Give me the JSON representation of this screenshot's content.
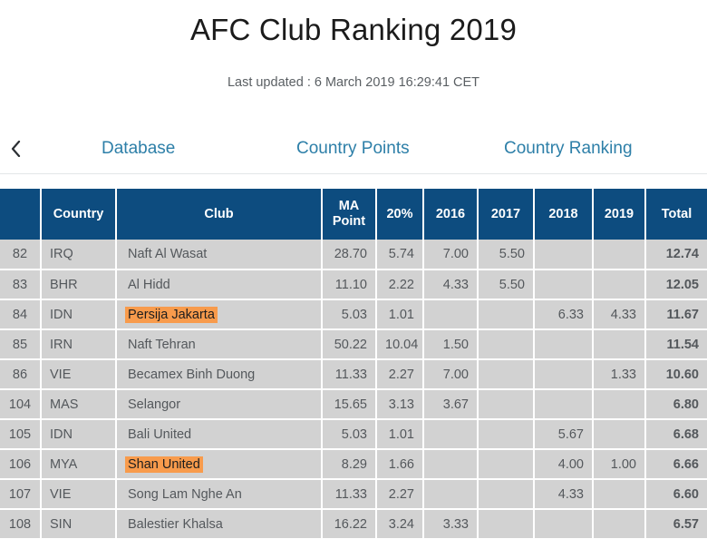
{
  "header": {
    "title": "AFC Club Ranking 2019",
    "last_updated": "Last updated : 6 March 2019 16:29:41 CET"
  },
  "nav": {
    "back_icon": "chevron-left-icon",
    "tabs": [
      {
        "label": "Database"
      },
      {
        "label": "Country Points"
      },
      {
        "label": "Country Ranking"
      }
    ],
    "link_color": "#2d7fa8"
  },
  "table": {
    "header_bg": "#0d4c7f",
    "row_bg": "#d2d2d2",
    "highlight_color": "#f89b4c",
    "columns": [
      {
        "key": "rank",
        "label": ""
      },
      {
        "key": "country",
        "label": "Country"
      },
      {
        "key": "club",
        "label": "Club"
      },
      {
        "key": "ma",
        "label": "MA Point"
      },
      {
        "key": "pct",
        "label": "20%"
      },
      {
        "key": "y2016",
        "label": "2016"
      },
      {
        "key": "y2017",
        "label": "2017"
      },
      {
        "key": "y2018",
        "label": "2018"
      },
      {
        "key": "y2019",
        "label": "2019"
      },
      {
        "key": "total",
        "label": "Total"
      }
    ],
    "rows": [
      {
        "rank": "82",
        "country": "IRQ",
        "club": "Naft Al Wasat",
        "highlight": false,
        "ma": "28.70",
        "pct": "5.74",
        "y2016": "7.00",
        "y2017": "5.50",
        "y2018": "",
        "y2019": "",
        "total": "12.74"
      },
      {
        "rank": "83",
        "country": "BHR",
        "club": "Al Hidd",
        "highlight": false,
        "ma": "11.10",
        "pct": "2.22",
        "y2016": "4.33",
        "y2017": "5.50",
        "y2018": "",
        "y2019": "",
        "total": "12.05"
      },
      {
        "rank": "84",
        "country": "IDN",
        "club": "Persija Jakarta",
        "highlight": true,
        "ma": "5.03",
        "pct": "1.01",
        "y2016": "",
        "y2017": "",
        "y2018": "6.33",
        "y2019": "4.33",
        "total": "11.67"
      },
      {
        "rank": "85",
        "country": "IRN",
        "club": "Naft Tehran",
        "highlight": false,
        "ma": "50.22",
        "pct": "10.04",
        "y2016": "1.50",
        "y2017": "",
        "y2018": "",
        "y2019": "",
        "total": "11.54"
      },
      {
        "rank": "86",
        "country": "VIE",
        "club": "Becamex Binh Duong",
        "highlight": false,
        "ma": "11.33",
        "pct": "2.27",
        "y2016": "7.00",
        "y2017": "",
        "y2018": "",
        "y2019": "1.33",
        "total": "10.60"
      },
      {
        "rank": "104",
        "country": "MAS",
        "club": "Selangor",
        "highlight": false,
        "ma": "15.65",
        "pct": "3.13",
        "y2016": "3.67",
        "y2017": "",
        "y2018": "",
        "y2019": "",
        "total": "6.80"
      },
      {
        "rank": "105",
        "country": "IDN",
        "club": "Bali United",
        "highlight": false,
        "ma": "5.03",
        "pct": "1.01",
        "y2016": "",
        "y2017": "",
        "y2018": "5.67",
        "y2019": "",
        "total": "6.68"
      },
      {
        "rank": "106",
        "country": "MYA",
        "club": "Shan United",
        "highlight": true,
        "ma": "8.29",
        "pct": "1.66",
        "y2016": "",
        "y2017": "",
        "y2018": "4.00",
        "y2019": "1.00",
        "total": "6.66"
      },
      {
        "rank": "107",
        "country": "VIE",
        "club": "Song Lam Nghe An",
        "highlight": false,
        "ma": "11.33",
        "pct": "2.27",
        "y2016": "",
        "y2017": "",
        "y2018": "4.33",
        "y2019": "",
        "total": "6.60"
      },
      {
        "rank": "108",
        "country": "SIN",
        "club": "Balestier Khalsa",
        "highlight": false,
        "ma": "16.22",
        "pct": "3.24",
        "y2016": "3.33",
        "y2017": "",
        "y2018": "",
        "y2019": "",
        "total": "6.57"
      }
    ]
  }
}
